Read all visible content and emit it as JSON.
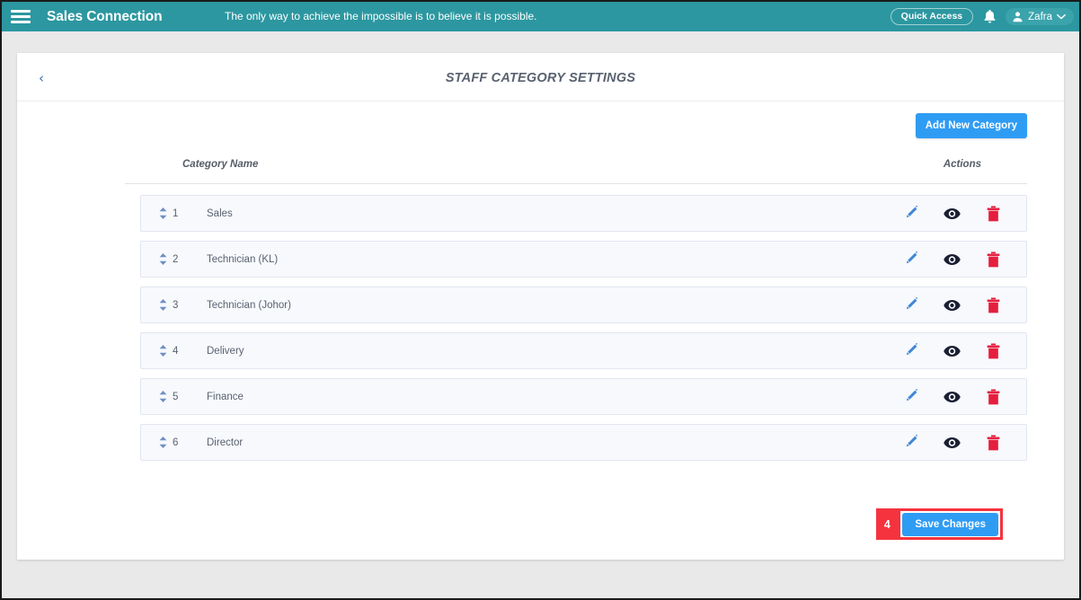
{
  "navbar": {
    "menu_icon": "hamburger-icon",
    "brand": "Sales Connection",
    "quote": "The only way to achieve the impossible is to believe it is possible.",
    "quick_access_label": "Quick Access",
    "bell_icon": "bell-icon",
    "user_name": "Zafra",
    "teal": "#2c97a0"
  },
  "page": {
    "back_label": "‹",
    "title": "STAFF CATEGORY SETTINGS",
    "add_button": "Add New Category",
    "accent_blue": "#2f9cf4",
    "annotation_red": "#f5333f"
  },
  "table": {
    "columns": {
      "name": "Category Name",
      "actions": "Actions"
    },
    "rows": [
      {
        "index": "1",
        "name": "Sales"
      },
      {
        "index": "2",
        "name": "Technician (KL)"
      },
      {
        "index": "3",
        "name": "Technician (Johor)"
      },
      {
        "index": "4",
        "name": "Delivery"
      },
      {
        "index": "5",
        "name": "Finance"
      },
      {
        "index": "6",
        "name": "Director"
      }
    ],
    "action_icons": [
      "pencil-icon",
      "eye-icon",
      "trash-icon"
    ]
  },
  "footer": {
    "annotation_number": "4",
    "save_label": "Save Changes"
  }
}
